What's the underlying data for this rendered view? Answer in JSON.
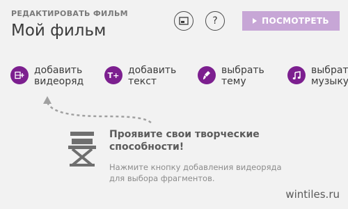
{
  "header": {
    "subtitle": "РЕДАКТИРОВАТЬ ФИЛЬМ",
    "title": "Мой фильм",
    "help_label": "?",
    "play_label": "ПОСМОТРЕТЬ"
  },
  "actions": [
    {
      "line1": "добавить",
      "line2": "видеоряд",
      "icon": "add-video-icon"
    },
    {
      "line1": "добавить",
      "line2": "текст",
      "icon": "add-text-icon"
    },
    {
      "line1": "выбрать",
      "line2": "тему",
      "icon": "theme-brush-icon"
    },
    {
      "line1": "выбрать",
      "line2": "музыку",
      "icon": "music-note-icon"
    }
  ],
  "empty_state": {
    "title_line1": "Проявите свои творческие",
    "title_line2": "способности!",
    "desc_line1": "Нажмите кнопку добавления видеоряда",
    "desc_line2": "для выбора фрагментов.",
    "icon": "director-chair-icon"
  },
  "watermark": "wintiles.ru",
  "colors": {
    "accent": "#7c1f8f",
    "play_button": "#c7a6d6",
    "background": "#f2f2f2"
  }
}
